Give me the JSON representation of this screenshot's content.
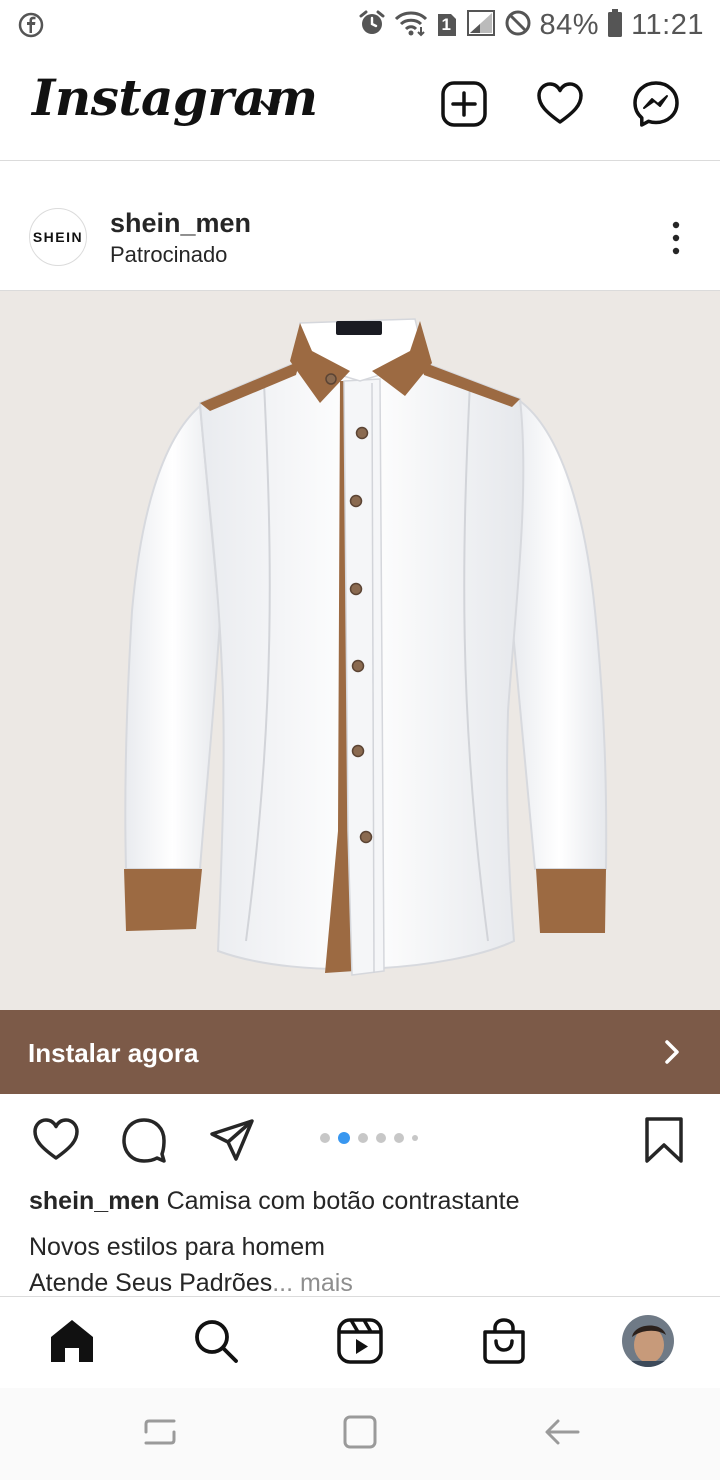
{
  "status_bar": {
    "battery": "84%",
    "time": "11:21",
    "sim_badge": "1",
    "icons": [
      "facebook-icon",
      "alarm-icon",
      "wifi-icon",
      "sim-icon",
      "signal-icon",
      "dnd-icon",
      "battery-icon"
    ]
  },
  "header": {
    "logo": "Instagram",
    "icons": [
      "chevron-down-icon",
      "new-post-icon",
      "activity-heart-icon",
      "messenger-icon"
    ]
  },
  "post": {
    "brand_avatar_text": "SHEIN",
    "username": "shein_men",
    "sponsored_label": "Patrocinado",
    "cta_label": "Instalar agora",
    "carousel": {
      "count": 6,
      "active_index": 1
    },
    "caption": {
      "username": "shein_men",
      "text": "Camisa com botão contrastante",
      "line2": "Novos estilos para homem",
      "line3": "Atende Seus Padrões",
      "ellipsis": "...",
      "more": "mais"
    }
  },
  "colors": {
    "cta_bg": "#7c5a48",
    "image_bg": "#ece8e4",
    "active_dot": "#3897f0",
    "divider": "#dbdbdb"
  },
  "bottom_nav": {
    "items": [
      "home-icon",
      "search-icon",
      "reels-icon",
      "shop-icon",
      "profile-avatar"
    ]
  },
  "system_nav": {
    "items": [
      "recent-apps-icon",
      "home-square-icon",
      "back-icon"
    ]
  }
}
